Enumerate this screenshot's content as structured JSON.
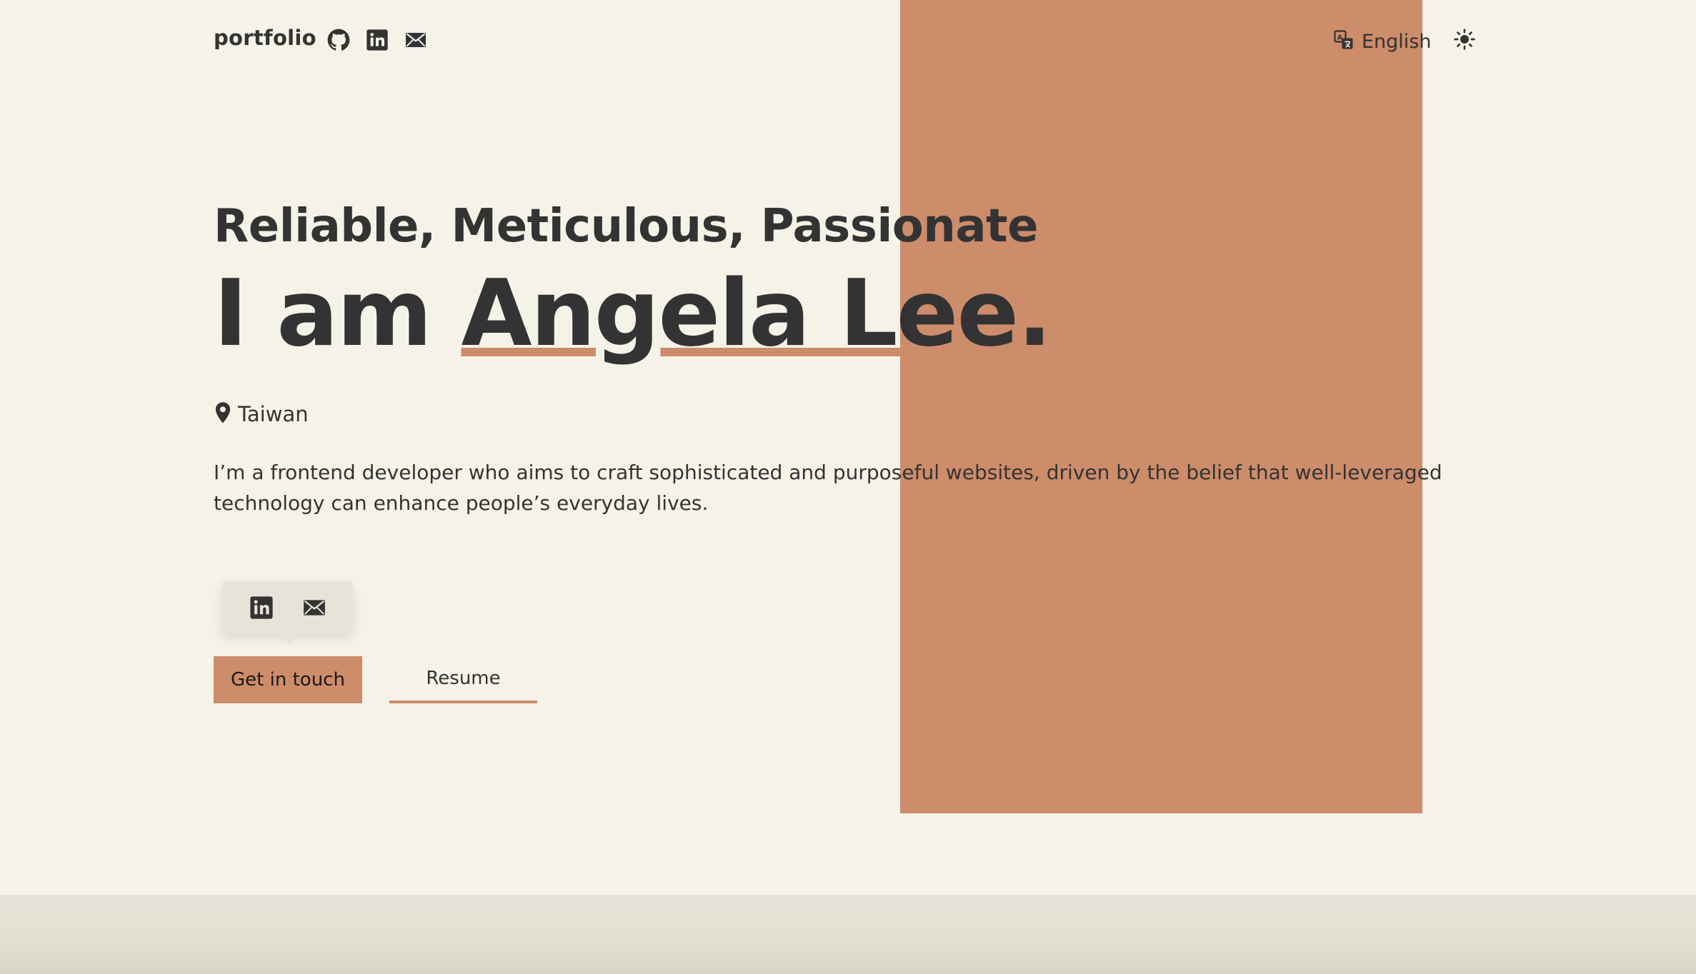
{
  "header": {
    "brand": "portfolio",
    "social_icons": [
      "github-icon",
      "linkedin-icon",
      "mail-icon"
    ],
    "language_label": "English",
    "language_icon": "translate-icon",
    "theme_icon": "sun-icon"
  },
  "hero": {
    "tagline": "Reliable, Meticulous, Passionate",
    "intro_prefix": "I am ",
    "name": "Angela Lee",
    "intro_suffix": ".",
    "location_icon": "map-pin-icon",
    "location": "Taiwan",
    "bio": "I’m a frontend developer who aims to craft sophisticated and purposeful websites, driven by the belief that well-leveraged technology can enhance people’s everyday lives.",
    "tooltip_icons": [
      "linkedin-icon",
      "mail-icon"
    ],
    "cta_label": "Get in touch",
    "resume_label": "Resume"
  },
  "colors": {
    "background": "#f5f2e7",
    "accent": "#cd8c6a",
    "text": "#333333",
    "tooltip": "#e8e3d8",
    "footer": "#e7e3d8"
  }
}
